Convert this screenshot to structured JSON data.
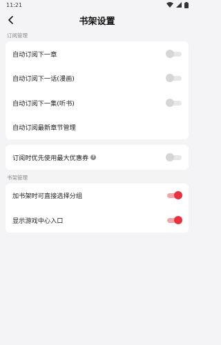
{
  "status_bar": {
    "time": "11:21"
  },
  "nav": {
    "title": "书架设置"
  },
  "sections": {
    "subscription_label": "订阅管理",
    "bookshelf_label": "书架管理"
  },
  "subscription_rows": [
    {
      "label": "自动订阅下一章",
      "toggle_on": false
    },
    {
      "label": "自动订阅下一话(漫画)",
      "toggle_on": false
    },
    {
      "label": "自动订阅下一集(听书)",
      "toggle_on": false
    },
    {
      "label": "自动订阅最新章节管理"
    }
  ],
  "coupon_row": {
    "label": "订阅时优先使用最大优惠券",
    "help_symbol": "?",
    "toggle_on": false
  },
  "bookshelf_rows": [
    {
      "label": "加书架时可直接选择分组",
      "toggle_on": true
    },
    {
      "label": "显示游戏中心入口",
      "toggle_on": true
    }
  ],
  "colors": {
    "accent": "#e8333f",
    "accent_track": "#f2a6ab",
    "background": "#f4f4f6"
  },
  "icons": [
    "wifi-icon",
    "signal-icon",
    "battery-icon",
    "back-arrow-icon",
    "help-circle-icon"
  ]
}
